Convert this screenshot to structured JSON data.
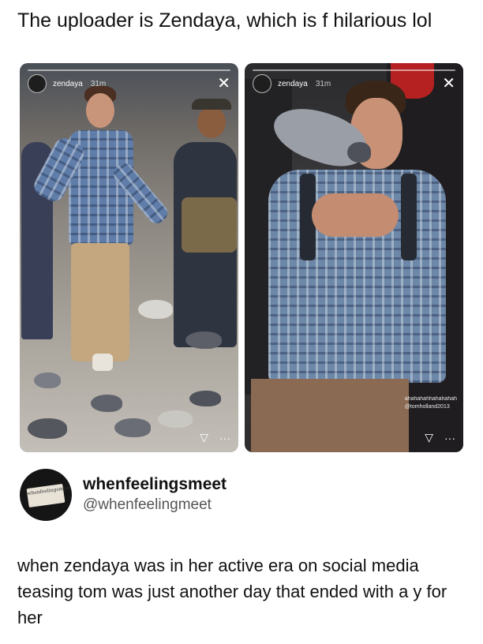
{
  "caption": "The uploader is Zendaya, which is f hilarious lol",
  "stories": [
    {
      "username": "zendaya",
      "time": "31m",
      "close_glyph": "✕",
      "send_glyph": "▽",
      "more_glyph": "···"
    },
    {
      "username": "zendaya",
      "time": "31m",
      "close_glyph": "✕",
      "send_glyph": "▽",
      "more_glyph": "···",
      "watermark_line1": "ahahahahhahahahah",
      "watermark_line2": "@tomholland2013"
    }
  ],
  "tweet": {
    "display_name": "whenfeelingsmeet",
    "handle": "@whenfeelingmeet",
    "avatar_card_text": "whenfeelingsmeet",
    "text": "when zendaya was in her active era on social media teasing tom was just another day that ended with a y for her"
  }
}
